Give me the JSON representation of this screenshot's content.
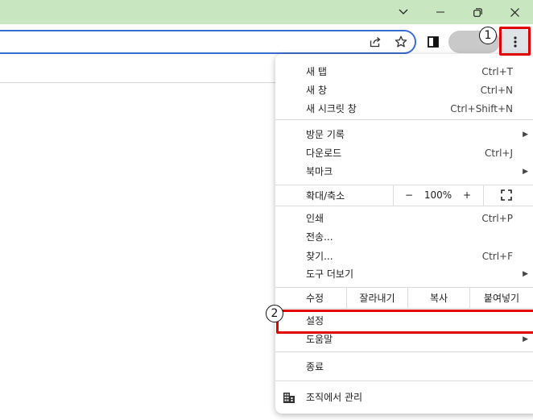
{
  "menu": {
    "new_tab": {
      "label": "새 탭",
      "shortcut": "Ctrl+T"
    },
    "new_window": {
      "label": "새 창",
      "shortcut": "Ctrl+N"
    },
    "new_incognito": {
      "label": "새 시크릿 창",
      "shortcut": "Ctrl+Shift+N"
    },
    "history": {
      "label": "방문 기록"
    },
    "downloads": {
      "label": "다운로드",
      "shortcut": "Ctrl+J"
    },
    "bookmarks": {
      "label": "북마크"
    },
    "zoom": {
      "label": "확대/축소",
      "minus": "−",
      "value": "100%",
      "plus": "+"
    },
    "print": {
      "label": "인쇄",
      "shortcut": "Ctrl+P"
    },
    "cast": {
      "label": "전송..."
    },
    "find": {
      "label": "찾기...",
      "shortcut": "Ctrl+F"
    },
    "more_tools": {
      "label": "도구 더보기"
    },
    "edit": {
      "label": "수정",
      "cut": "잘라내기",
      "copy": "복사",
      "paste": "붙여넣기"
    },
    "settings": {
      "label": "설정"
    },
    "help": {
      "label": "도움말"
    },
    "exit": {
      "label": "종료"
    },
    "managed": {
      "label": "조직에서 관리"
    }
  },
  "annotations": {
    "step1": "1",
    "step2": "2",
    "highlight_color": "#e00000"
  },
  "colors": {
    "titlebar": "#c8e7c0",
    "omnibox_border": "#3b6ccf"
  },
  "icons": [
    "chevron-down-icon",
    "minimize-icon",
    "restore-icon",
    "close-icon",
    "share-icon",
    "star-icon",
    "side-panel-icon",
    "kebab-menu-icon",
    "fullscreen-icon",
    "building-icon",
    "submenu-arrow-icon"
  ]
}
